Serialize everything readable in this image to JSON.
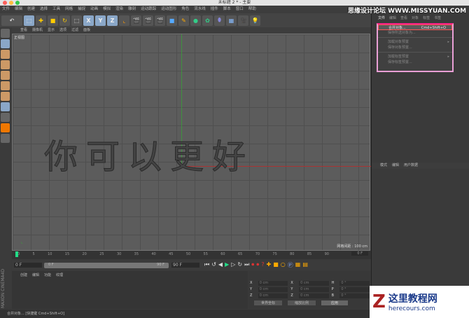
{
  "window": {
    "title": "未标题 2 * - 主要"
  },
  "menu": [
    "文件",
    "编辑",
    "创建",
    "选择",
    "工具",
    "网格",
    "捕捉",
    "动画",
    "模拟",
    "渲染",
    "雕刻",
    "运动跟踪",
    "运动图形",
    "角色",
    "流水线",
    "插件",
    "脚本",
    "窗口",
    "帮助"
  ],
  "toolbar": {
    "x": "X",
    "y": "Y",
    "z": "Z"
  },
  "viewport": {
    "menu": [
      "查看",
      "摄像机",
      "显示",
      "选项",
      "过滤",
      "面板"
    ],
    "label": "正视图",
    "grid_spacing": "网格间距 : 100 cm",
    "text": "你可以更好"
  },
  "object_manager": {
    "tabs": [
      "文件",
      "编辑",
      "查看",
      "对象",
      "标签",
      "书签"
    ]
  },
  "dropdown": {
    "items": [
      {
        "label": "合并对象...",
        "shortcut": "Cmd+Shift+O"
      },
      {
        "label": "保存所选对象为..."
      },
      {
        "label": "加载对象预置",
        "arrow": "▸"
      },
      {
        "label": "保存对象预置..."
      },
      {
        "label": "加载标签预置",
        "arrow": "▸"
      },
      {
        "label": "保存标签预置..."
      }
    ]
  },
  "attributes": {
    "tabs": [
      "模式",
      "编辑",
      "用户数据"
    ]
  },
  "timeline": {
    "ticks": [
      "0",
      "5",
      "10",
      "15",
      "20",
      "25",
      "30",
      "35",
      "40",
      "45",
      "50",
      "55",
      "60",
      "65",
      "70",
      "75",
      "80",
      "85",
      "90"
    ],
    "current": "0 F",
    "start": "0 F",
    "range_start": "0 F",
    "range_end": "90 F",
    "end": "90 F"
  },
  "material_manager": {
    "menu": [
      "创建",
      "编辑",
      "功能",
      "纹理"
    ],
    "logo": "MAXON CINEMA4D"
  },
  "coordinates": {
    "rows": [
      {
        "a": "X",
        "av": "0 cm",
        "b": "X",
        "bv": "0 cm",
        "c": "H",
        "cv": "0 °"
      },
      {
        "a": "Y",
        "av": "0 cm",
        "b": "Y",
        "bv": "0 cm",
        "c": "P",
        "cv": "0 °"
      },
      {
        "a": "Z",
        "av": "0 cm",
        "b": "Z",
        "bv": "0 cm",
        "c": "B",
        "cv": "0 °"
      }
    ],
    "mode": "世界坐标",
    "scale": "缩放比例",
    "apply": "应用"
  },
  "status": "合并对象... [快捷键 Cmd+Shift+O]",
  "watermarks": {
    "top": "思缘设计论坛 WWW.MISSYUAN.COM",
    "bottom_title": "这里教程网",
    "bottom_url": "herecours.com"
  }
}
